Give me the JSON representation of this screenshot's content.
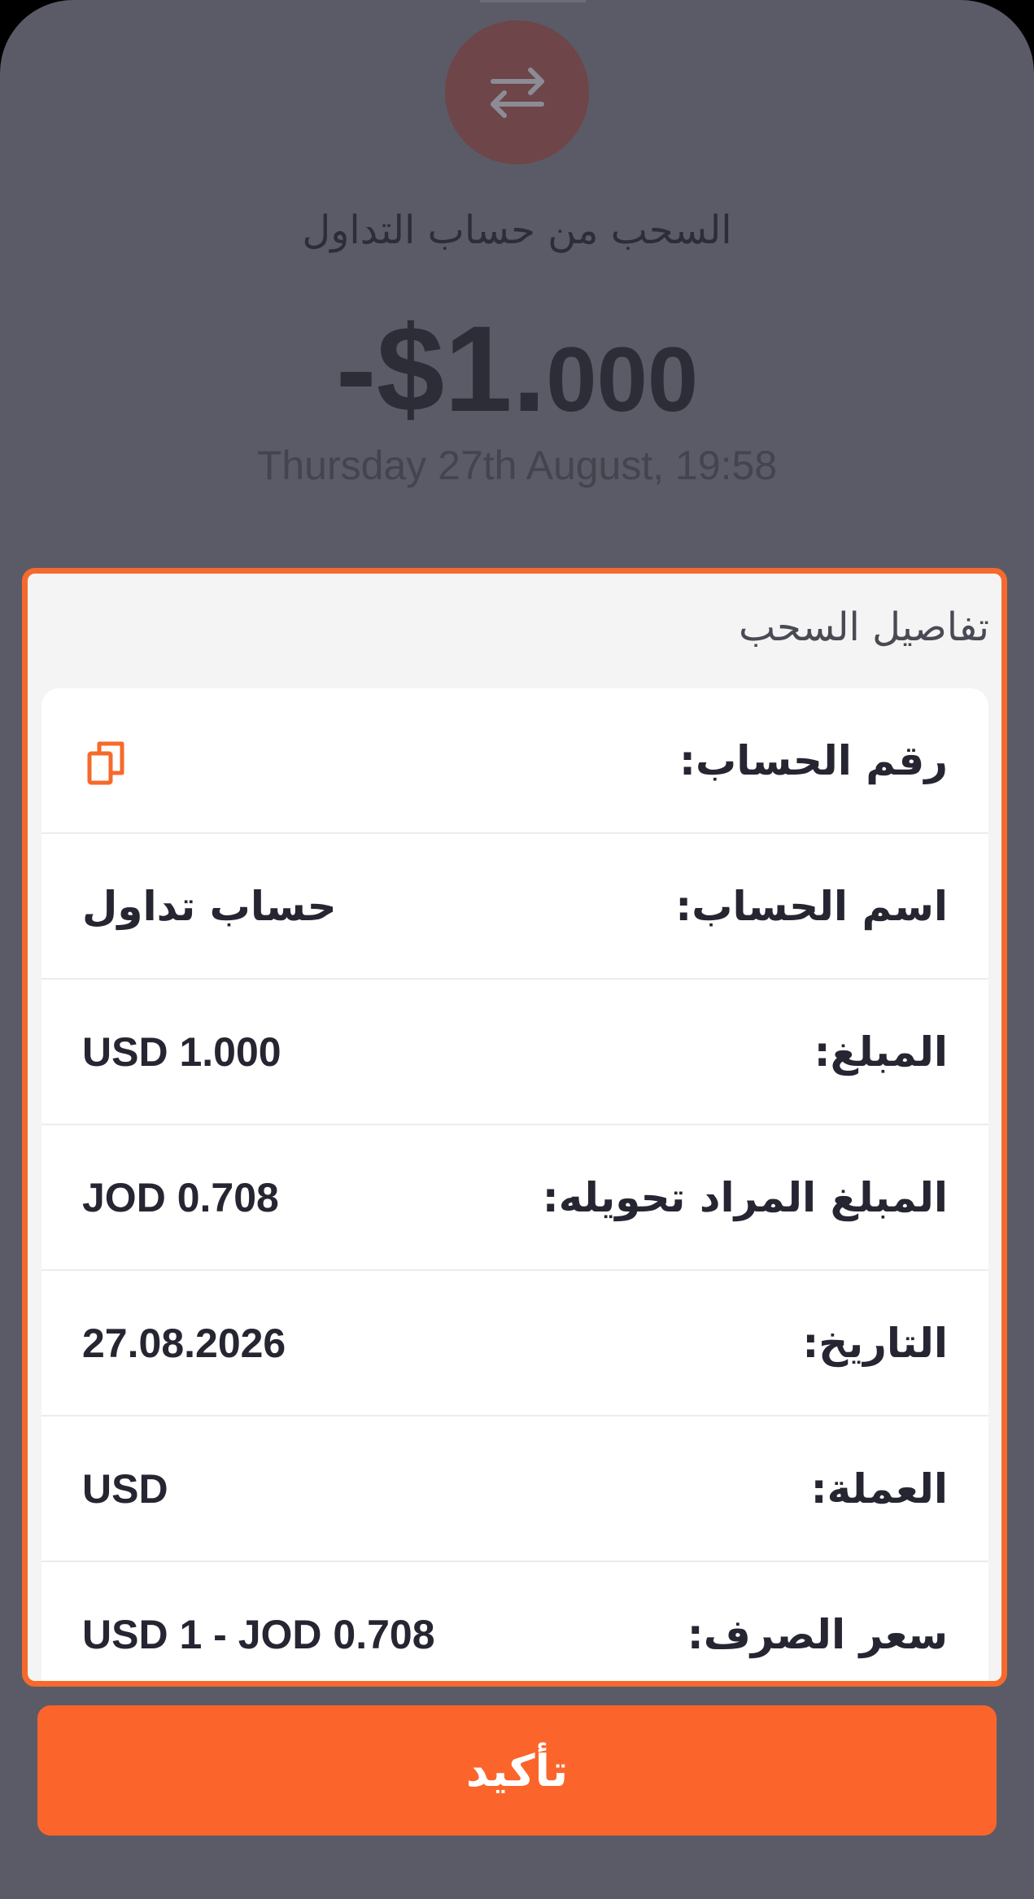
{
  "header": {
    "icon": "transfer-arrows-icon",
    "title": "السحب من حساب التداول",
    "amount_main": "-$1.",
    "amount_decimal": "000",
    "datetime": "Thursday 27th August, 19:58"
  },
  "details": {
    "title": "تفاصيل السحب",
    "rows": [
      {
        "label": "رقم الحساب:",
        "value": "",
        "action_icon": "copy-icon"
      },
      {
        "label": "اسم الحساب:",
        "value": "حساب تداول"
      },
      {
        "label": "المبلغ:",
        "value": "USD 1.000"
      },
      {
        "label": "المبلغ المراد تحويله:",
        "value": "JOD 0.708"
      },
      {
        "label": "التاريخ:",
        "value": "27.08.2026"
      },
      {
        "label": "العملة:",
        "value": "USD"
      },
      {
        "label": "سعر الصرف:",
        "value": "USD 1 - JOD 0.708"
      }
    ]
  },
  "actions": {
    "confirm_label": "تأكيد"
  },
  "colors": {
    "accent": "#fb652b",
    "overlay": "#5b5b67",
    "icon_circle": "#6e4548",
    "text_dark": "#262632"
  }
}
